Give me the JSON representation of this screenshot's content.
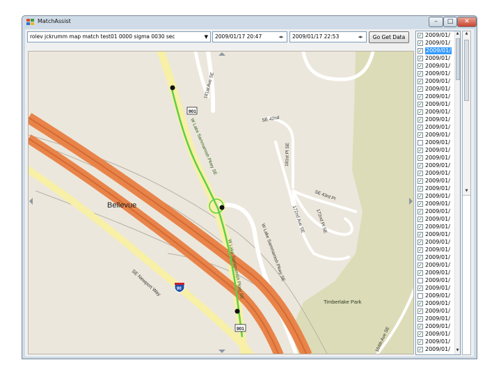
{
  "window": {
    "title": "MatchAssist",
    "minimize": "–",
    "maximize": "□",
    "close": "✕"
  },
  "toolbar": {
    "track_selected": "rolev jckrumm map match test01 0000 sigma 0030 sec",
    "start_time": "2009/01/17 20:47",
    "end_time": "2009/01/17 22:53",
    "get_data_label": "Go Get Data",
    "dropdown_icon": "chevron-down-icon",
    "spin_icon": "calendar-icon"
  },
  "map": {
    "labels": {
      "city": "Bellevue",
      "park": "Timberlake Park",
      "highway_shield_top": "901",
      "highway_shield_bottom": "901",
      "interstate": "90",
      "road_parkway_north": "W Lake Sammamish Pkwy SE",
      "road_parkway_south": "W Lake Sammamish Pkwy SE",
      "road_parkway_east": "W Lake Sammamish Pkwy SE",
      "road_newport": "SE Newport Way",
      "road_181": "181st Ave SE",
      "road_42nd": "SE 42nd",
      "road_181_pl": "181st Pl SE",
      "road_43rd": "SE 43rd Pl",
      "road_172": "172nd Ave SE",
      "road_172_pl": "172nd Pl SE",
      "road_164": "164th Ave SE"
    },
    "colors": {
      "background": "#ece7dc",
      "park": "#dcdcb8",
      "freeway": "#e8844a",
      "route": "#5ccf4a",
      "yellow_road": "#f7f0a6"
    }
  },
  "list": {
    "items": [
      {
        "label": "2009/01/",
        "checked": true,
        "selected": false
      },
      {
        "label": "2009/01/",
        "checked": true,
        "selected": false
      },
      {
        "label": "2009/01/",
        "checked": true,
        "selected": true
      },
      {
        "label": "2009/01/",
        "checked": true,
        "selected": false
      },
      {
        "label": "2009/01/",
        "checked": true,
        "selected": false
      },
      {
        "label": "2009/01/",
        "checked": true,
        "selected": false
      },
      {
        "label": "2009/01/",
        "checked": true,
        "selected": false
      },
      {
        "label": "2009/01/",
        "checked": true,
        "selected": false
      },
      {
        "label": "2009/01/",
        "checked": true,
        "selected": false
      },
      {
        "label": "2009/01/",
        "checked": true,
        "selected": false
      },
      {
        "label": "2009/01/",
        "checked": true,
        "selected": false
      },
      {
        "label": "2009/01/",
        "checked": true,
        "selected": false
      },
      {
        "label": "2009/01/",
        "checked": true,
        "selected": false
      },
      {
        "label": "2009/01/",
        "checked": true,
        "selected": false
      },
      {
        "label": "2009/01/",
        "checked": false,
        "selected": false
      },
      {
        "label": "2009/01/",
        "checked": true,
        "selected": false
      },
      {
        "label": "2009/01/",
        "checked": true,
        "selected": false
      },
      {
        "label": "2009/01/",
        "checked": true,
        "selected": false
      },
      {
        "label": "2009/01/",
        "checked": true,
        "selected": false
      },
      {
        "label": "2009/01/",
        "checked": true,
        "selected": false
      },
      {
        "label": "2009/01/",
        "checked": true,
        "selected": false
      },
      {
        "label": "2009/01/",
        "checked": true,
        "selected": false
      },
      {
        "label": "2009/01/",
        "checked": true,
        "selected": false
      },
      {
        "label": "2009/01/",
        "checked": true,
        "selected": false
      },
      {
        "label": "2009/01/",
        "checked": true,
        "selected": false
      },
      {
        "label": "2009/01/",
        "checked": true,
        "selected": false
      },
      {
        "label": "2009/01/",
        "checked": true,
        "selected": false
      },
      {
        "label": "2009/01/",
        "checked": true,
        "selected": false
      },
      {
        "label": "2009/01/",
        "checked": true,
        "selected": false
      },
      {
        "label": "2009/01/",
        "checked": true,
        "selected": false
      },
      {
        "label": "2009/01/",
        "checked": true,
        "selected": false
      },
      {
        "label": "2009/01/",
        "checked": true,
        "selected": false
      },
      {
        "label": "2009/01/",
        "checked": false,
        "selected": false
      },
      {
        "label": "2009/01/",
        "checked": true,
        "selected": false
      },
      {
        "label": "2009/01/",
        "checked": false,
        "selected": false
      },
      {
        "label": "2009/01/",
        "checked": true,
        "selected": false
      },
      {
        "label": "2009/01/",
        "checked": true,
        "selected": false
      },
      {
        "label": "2009/01/",
        "checked": true,
        "selected": false
      },
      {
        "label": "2009/01/",
        "checked": true,
        "selected": false
      },
      {
        "label": "2009/01/",
        "checked": true,
        "selected": false
      },
      {
        "label": "2009/01/",
        "checked": true,
        "selected": false
      },
      {
        "label": "2009/01/",
        "checked": true,
        "selected": false
      }
    ]
  }
}
